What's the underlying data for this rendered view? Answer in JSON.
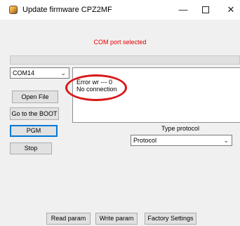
{
  "window": {
    "title": "Update firmware CPZ2MF",
    "controls": {
      "minimize": "—",
      "close": "✕"
    }
  },
  "status": {
    "text": "COM port selected",
    "color": "#e00000"
  },
  "port_select": {
    "value": "COM14"
  },
  "buttons": {
    "open_file": "Open File",
    "boot": "Go to the BOOT",
    "pgm": "PGM",
    "stop": "Stop",
    "read_param": "Read param",
    "write_param": "Write param",
    "factory": "Factory Settings"
  },
  "log": {
    "lines": [
      "Error wr ---  0",
      "No connection"
    ]
  },
  "protocol": {
    "label": "Type protocol",
    "value": "Protocol"
  },
  "icons": {
    "app": "firmware-app-icon",
    "dropdown": "chevron-down-icon"
  },
  "colors": {
    "accent": "#0078d7",
    "annotation": "#d81818"
  }
}
